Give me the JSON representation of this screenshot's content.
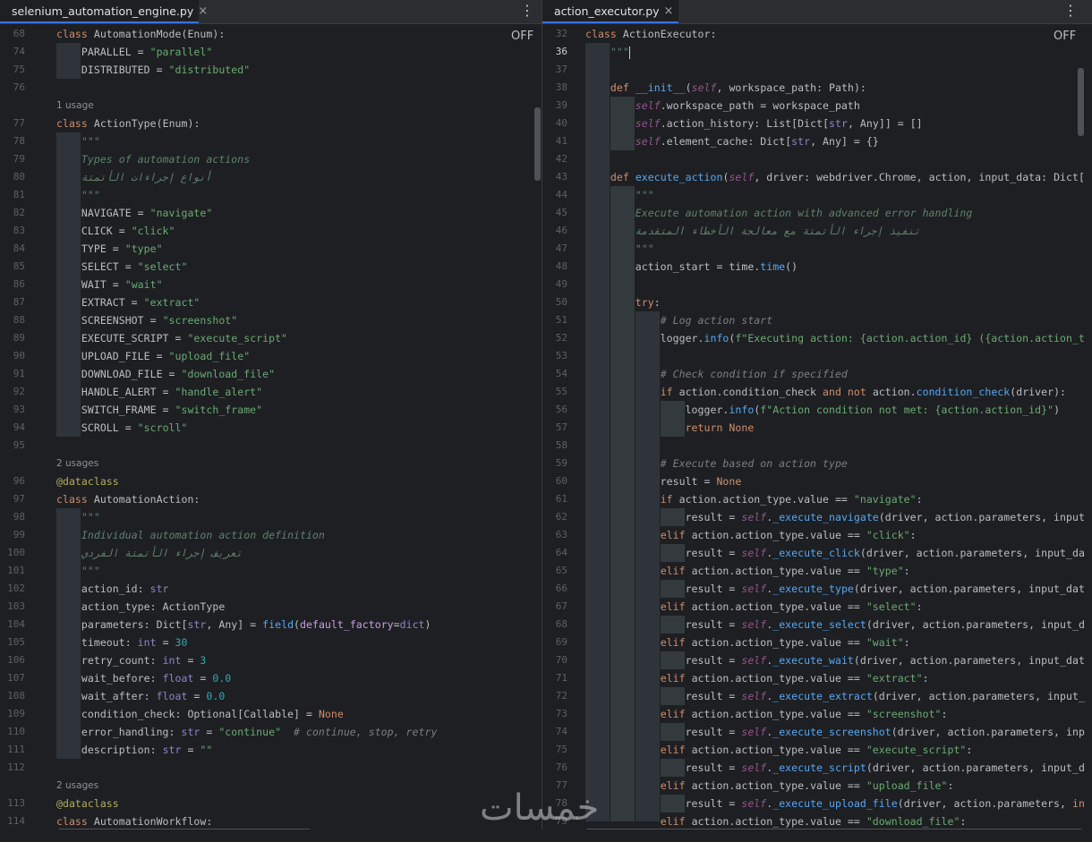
{
  "left": {
    "tab": "selenium_automation_engine.py",
    "off_label": "OFF",
    "lines": [
      {
        "ln": "68",
        "t": "class AutomationMode(Enum):"
      },
      {
        "ln": "74",
        "t": "    PARALLEL = \"parallel\""
      },
      {
        "ln": "75",
        "t": "    DISTRIBUTED = \"distributed\""
      },
      {
        "ln": "76",
        "t": ""
      },
      {
        "usage": "1 usage"
      },
      {
        "ln": "77",
        "t": "class ActionType(Enum):"
      },
      {
        "ln": "78",
        "t": "    \"\"\""
      },
      {
        "ln": "79",
        "t": "    Types of automation actions"
      },
      {
        "ln": "80",
        "t": "    أنواع إجراءات الأتمتة"
      },
      {
        "ln": "81",
        "t": "    \"\"\""
      },
      {
        "ln": "82",
        "t": "    NAVIGATE = \"navigate\""
      },
      {
        "ln": "83",
        "t": "    CLICK = \"click\""
      },
      {
        "ln": "84",
        "t": "    TYPE = \"type\""
      },
      {
        "ln": "85",
        "t": "    SELECT = \"select\""
      },
      {
        "ln": "86",
        "t": "    WAIT = \"wait\""
      },
      {
        "ln": "87",
        "t": "    EXTRACT = \"extract\""
      },
      {
        "ln": "88",
        "t": "    SCREENSHOT = \"screenshot\""
      },
      {
        "ln": "89",
        "t": "    EXECUTE_SCRIPT = \"execute_script\""
      },
      {
        "ln": "90",
        "t": "    UPLOAD_FILE = \"upload_file\""
      },
      {
        "ln": "91",
        "t": "    DOWNLOAD_FILE = \"download_file\""
      },
      {
        "ln": "92",
        "t": "    HANDLE_ALERT = \"handle_alert\""
      },
      {
        "ln": "93",
        "t": "    SWITCH_FRAME = \"switch_frame\""
      },
      {
        "ln": "94",
        "t": "    SCROLL = \"scroll\""
      },
      {
        "ln": "95",
        "t": ""
      },
      {
        "usage": "2 usages"
      },
      {
        "ln": "96",
        "t": "@dataclass"
      },
      {
        "ln": "97",
        "t": "class AutomationAction:"
      },
      {
        "ln": "98",
        "t": "    \"\"\""
      },
      {
        "ln": "99",
        "t": "    Individual automation action definition"
      },
      {
        "ln": "100",
        "t": "    تعريف إجراء الأتمتة الفردي"
      },
      {
        "ln": "101",
        "t": "    \"\"\""
      },
      {
        "ln": "102",
        "t": "    action_id: str"
      },
      {
        "ln": "103",
        "t": "    action_type: ActionType"
      },
      {
        "ln": "104",
        "t": "    parameters: Dict[str, Any] = field(default_factory=dict)"
      },
      {
        "ln": "105",
        "t": "    timeout: int = 30"
      },
      {
        "ln": "106",
        "t": "    retry_count: int = 3"
      },
      {
        "ln": "107",
        "t": "    wait_before: float = 0.0"
      },
      {
        "ln": "108",
        "t": "    wait_after: float = 0.0"
      },
      {
        "ln": "109",
        "t": "    condition_check: Optional[Callable] = None"
      },
      {
        "ln": "110",
        "t": "    error_handling: str = \"continue\"  # continue, stop, retry"
      },
      {
        "ln": "111",
        "t": "    description: str = \"\""
      },
      {
        "ln": "112",
        "t": ""
      },
      {
        "usage": "2 usages"
      },
      {
        "ln": "113",
        "t": "@dataclass"
      },
      {
        "ln": "114",
        "t": "class AutomationWorkflow:"
      }
    ]
  },
  "right": {
    "tab": "action_executor.py",
    "off_label": "OFF",
    "lines": [
      {
        "ln": "32",
        "t": "class ActionExecutor:"
      },
      {
        "ln": "36",
        "t": "    \"\"\"",
        "cur": true
      },
      {
        "ln": "37",
        "t": ""
      },
      {
        "ln": "38",
        "t": "    def __init__(self, workspace_path: Path):"
      },
      {
        "ln": "39",
        "t": "        self.workspace_path = workspace_path"
      },
      {
        "ln": "40",
        "t": "        self.action_history: List[Dict[str, Any]] = []"
      },
      {
        "ln": "41",
        "t": "        self.element_cache: Dict[str, Any] = {}"
      },
      {
        "ln": "42",
        "t": ""
      },
      {
        "ln": "43",
        "t": "    def execute_action(self, driver: webdriver.Chrome, action, input_data: Dict["
      },
      {
        "ln": "44",
        "t": "        \"\"\""
      },
      {
        "ln": "45",
        "t": "        Execute automation action with advanced error handling"
      },
      {
        "ln": "46",
        "t": "        تنفيذ إجراء الأتمتة مع معالجة الأخطاء المتقدمة"
      },
      {
        "ln": "47",
        "t": "        \"\"\""
      },
      {
        "ln": "48",
        "t": "        action_start = time.time()"
      },
      {
        "ln": "49",
        "t": ""
      },
      {
        "ln": "50",
        "t": "        try:"
      },
      {
        "ln": "51",
        "t": "            # Log action start"
      },
      {
        "ln": "52",
        "t": "            logger.info(f\"Executing action: {action.action_id} ({action.action_t"
      },
      {
        "ln": "53",
        "t": ""
      },
      {
        "ln": "54",
        "t": "            # Check condition if specified"
      },
      {
        "ln": "55",
        "t": "            if action.condition_check and not action.condition_check(driver):"
      },
      {
        "ln": "56",
        "t": "                logger.info(f\"Action condition not met: {action.action_id}\")"
      },
      {
        "ln": "57",
        "t": "                return None"
      },
      {
        "ln": "58",
        "t": ""
      },
      {
        "ln": "59",
        "t": "            # Execute based on action type"
      },
      {
        "ln": "60",
        "t": "            result = None"
      },
      {
        "ln": "61",
        "t": "            if action.action_type.value == \"navigate\":"
      },
      {
        "ln": "62",
        "t": "                result = self._execute_navigate(driver, action.parameters, input"
      },
      {
        "ln": "63",
        "t": "            elif action.action_type.value == \"click\":"
      },
      {
        "ln": "64",
        "t": "                result = self._execute_click(driver, action.parameters, input_da"
      },
      {
        "ln": "65",
        "t": "            elif action.action_type.value == \"type\":"
      },
      {
        "ln": "66",
        "t": "                result = self._execute_type(driver, action.parameters, input_dat"
      },
      {
        "ln": "67",
        "t": "            elif action.action_type.value == \"select\":"
      },
      {
        "ln": "68",
        "t": "                result = self._execute_select(driver, action.parameters, input_d"
      },
      {
        "ln": "69",
        "t": "            elif action.action_type.value == \"wait\":"
      },
      {
        "ln": "70",
        "t": "                result = self._execute_wait(driver, action.parameters, input_dat"
      },
      {
        "ln": "71",
        "t": "            elif action.action_type.value == \"extract\":"
      },
      {
        "ln": "72",
        "t": "                result = self._execute_extract(driver, action.parameters, input_"
      },
      {
        "ln": "73",
        "t": "            elif action.action_type.value == \"screenshot\":"
      },
      {
        "ln": "74",
        "t": "                result = self._execute_screenshot(driver, action.parameters, inp"
      },
      {
        "ln": "75",
        "t": "            elif action.action_type.value == \"execute_script\":"
      },
      {
        "ln": "76",
        "t": "                result = self._execute_script(driver, action.parameters, input_d"
      },
      {
        "ln": "77",
        "t": "            elif action.action_type.value == \"upload_file\":"
      },
      {
        "ln": "78",
        "t": "                result = self._execute_upload_file(driver, action.parameters, in"
      },
      {
        "ln": "79",
        "t": "            elif action.action_type.value == \"download_file\":"
      }
    ]
  },
  "watermark": "خمسات"
}
